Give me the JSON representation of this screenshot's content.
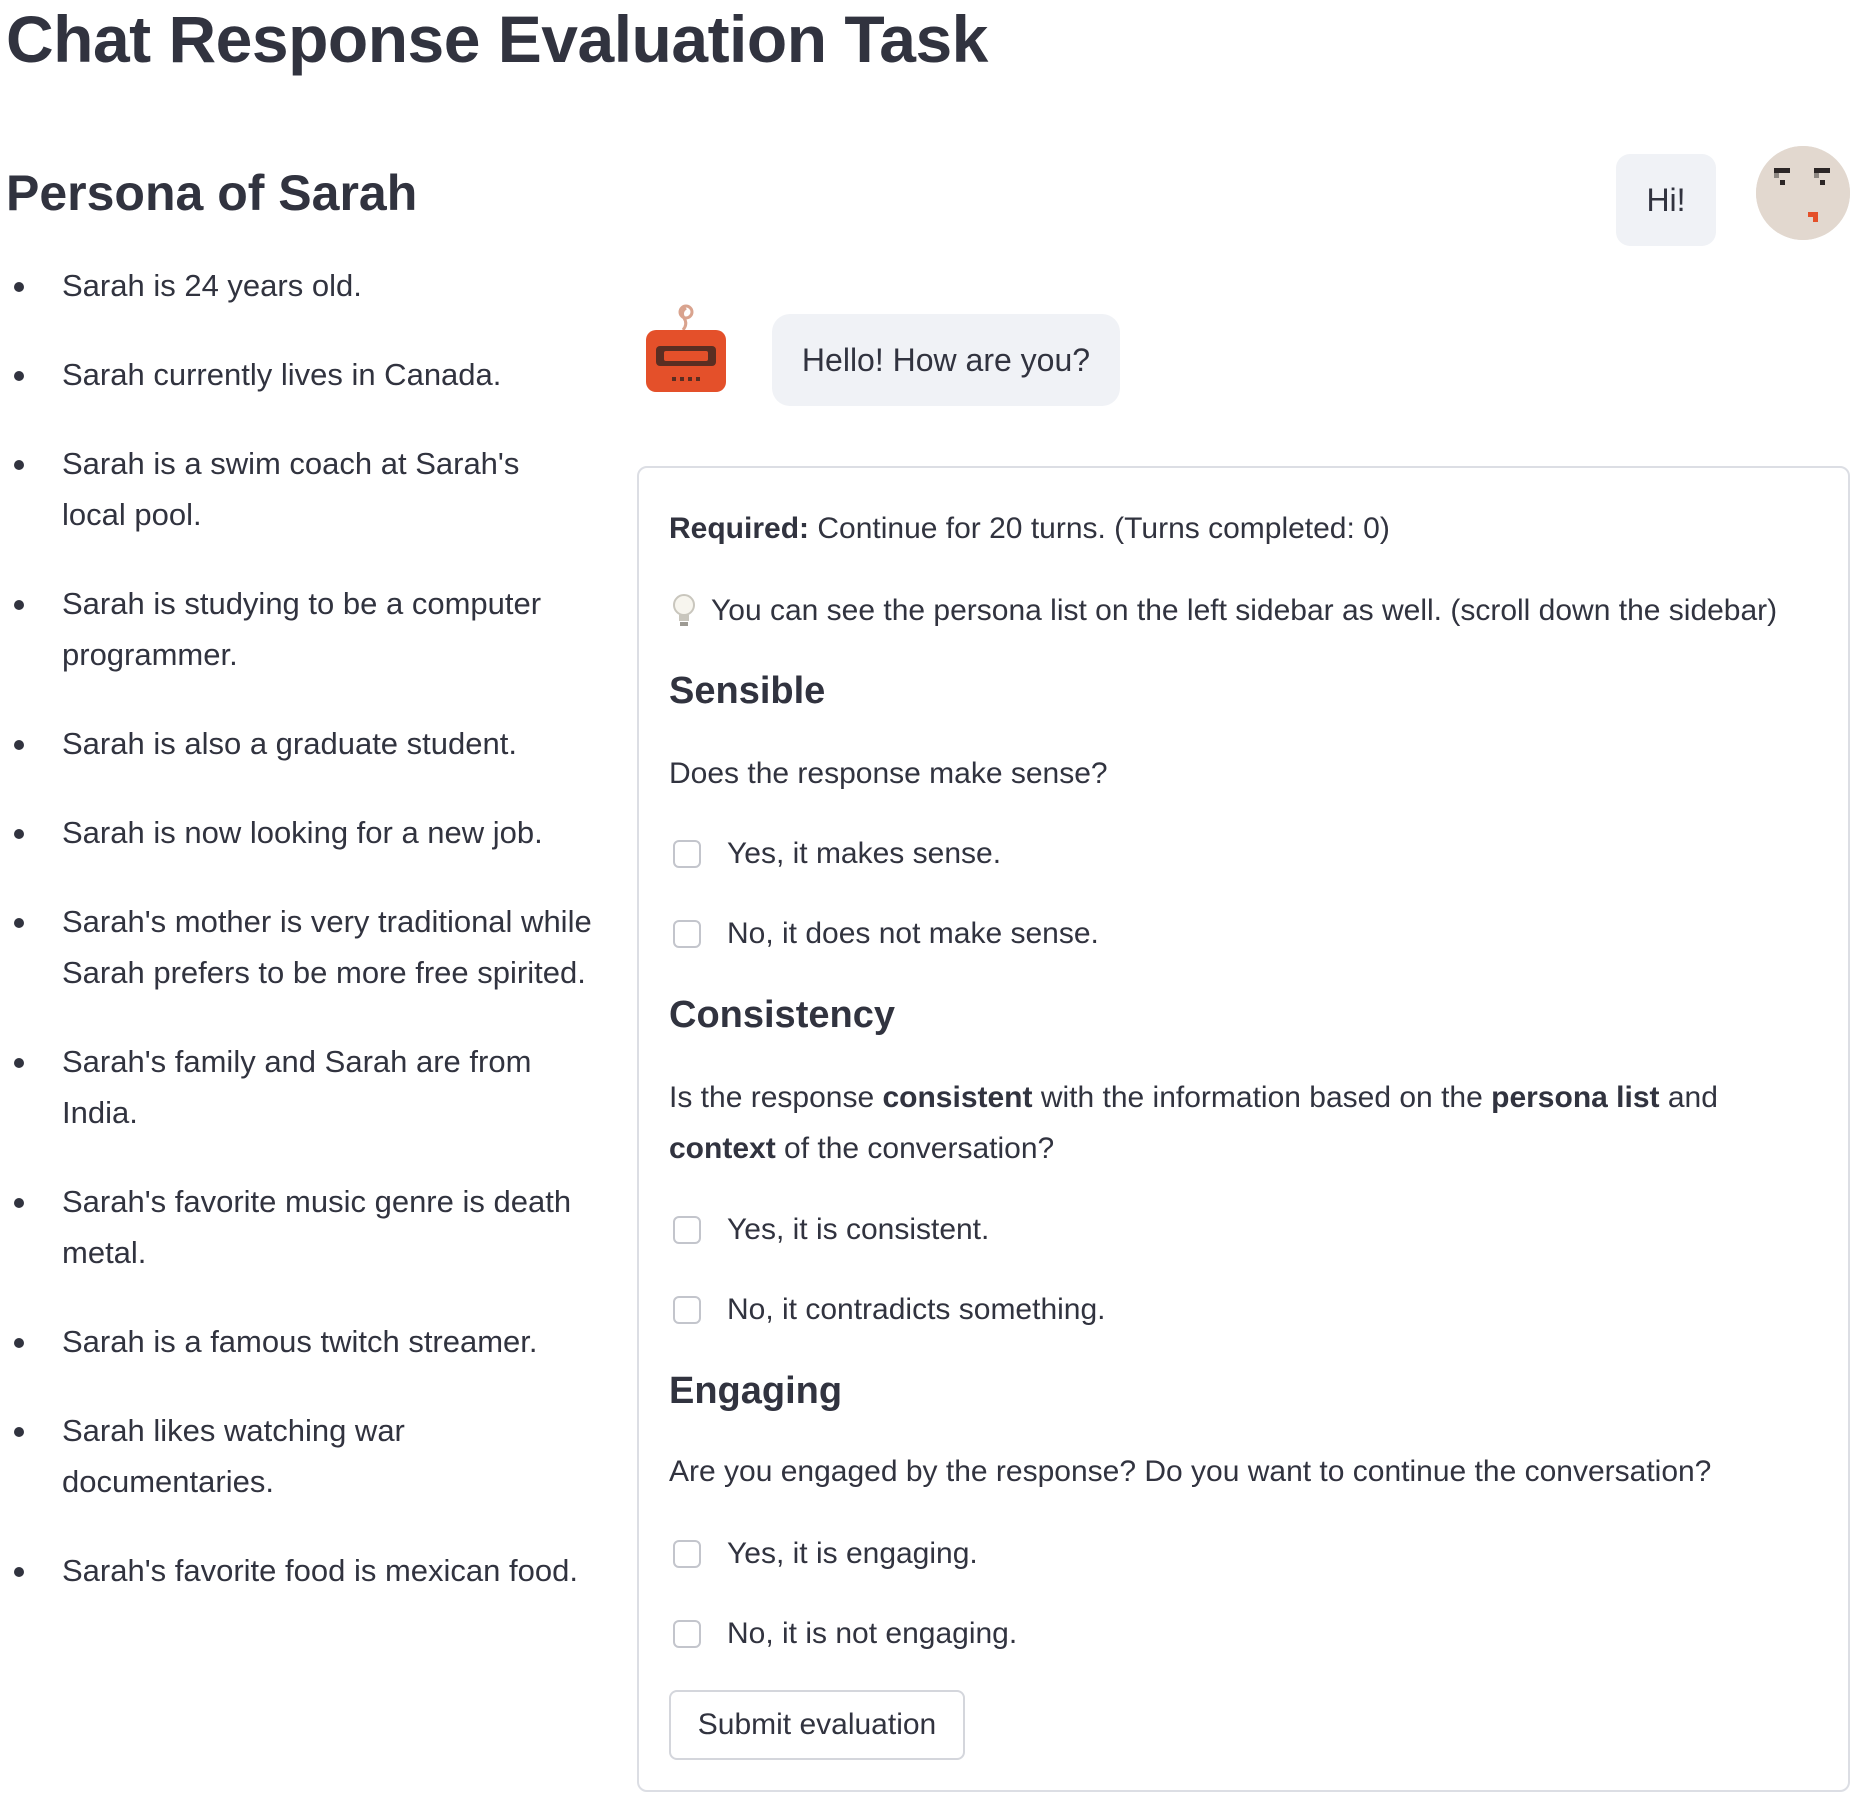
{
  "page": {
    "title": "Chat Response Evaluation Task"
  },
  "persona": {
    "heading": "Persona of Sarah",
    "items": [
      "Sarah is 24 years old.",
      "Sarah currently lives in Canada.",
      "Sarah is a swim coach at Sarah's local pool.",
      "Sarah is studying to be a computer programmer.",
      "Sarah is also a graduate student.",
      "Sarah is now looking for a new job.",
      "Sarah's mother is very traditional while Sarah prefers to be more free spirited.",
      "Sarah's family and Sarah are from India.",
      "Sarah's favorite music genre is death metal.",
      "Sarah is a famous twitch streamer.",
      "Sarah likes watching war documentaries.",
      "Sarah's favorite food is mexican food."
    ]
  },
  "chat": {
    "user_message": "Hi!",
    "bot_message": "Hello! How are you?",
    "user_avatar_icon": "pixel-face-avatar-icon",
    "bot_avatar_icon": "robot-avatar-icon"
  },
  "evaluation": {
    "required_label": "Required:",
    "required_text": " Continue for 20 turns. (Turns completed: 0)",
    "tip_icon": "lightbulb-icon",
    "tip_text": "You can see the persona list on the left sidebar as well. (scroll down the sidebar)",
    "sensible": {
      "heading": "Sensible",
      "question": "Does the response make sense?",
      "yes_label": "Yes, it makes sense.",
      "no_label": "No, it does not make sense."
    },
    "consistency": {
      "heading": "Consistency",
      "question_part1": "Is the response ",
      "question_bold1": "consistent",
      "question_part2": " with the information based on the ",
      "question_bold2": "persona list",
      "question_part3": " and ",
      "question_bold3": "context",
      "question_part4": " of the conversation?",
      "yes_label": "Yes, it is consistent.",
      "no_label": "No, it contradicts something."
    },
    "engaging": {
      "heading": "Engaging",
      "question": "Are you engaged by the response? Do you want to continue the conversation?",
      "yes_label": "Yes, it is engaging.",
      "no_label": "No, it is not engaging."
    },
    "submit_label": "Submit evaluation",
    "checkbox_states": {
      "sensible_yes": false,
      "sensible_no": false,
      "consistent_yes": false,
      "consistent_no": false,
      "engaging_yes": false,
      "engaging_no": false
    }
  },
  "colors": {
    "text": "#31333f",
    "bubble_bg": "#f0f2f6",
    "border": "#dcdee4",
    "bot_orange": "#e4502a"
  }
}
